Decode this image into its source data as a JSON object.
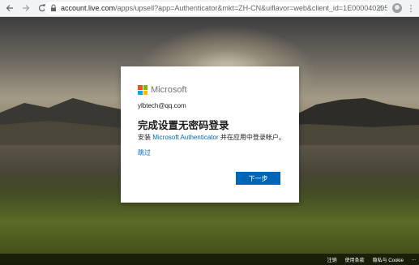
{
  "browser": {
    "url_host": "account.live.com",
    "url_path": "/apps/upsell?app=Authenticator&mkt=ZH-CN&uiflavor=web&client_id=1E0000402055498id=2..."
  },
  "dialog": {
    "brand": "Microsoft",
    "email": "ylbtech@qq.com",
    "title": "完成设置无密码登录",
    "desc_prefix": "安装 ",
    "desc_link": "Microsoft Authenticator",
    "desc_suffix": " 并在应用中登录帐户。",
    "skip_label": "跳过",
    "next_label": "下一步"
  },
  "footer": {
    "terms": "注销",
    "usage": "使用条款",
    "privacy": "隐私与 Cookie",
    "more": "..."
  },
  "colors": {
    "accent": "#0067b8",
    "ms_red": "#f25022",
    "ms_green": "#7fba00",
    "ms_blue": "#00a4ef",
    "ms_yellow": "#ffb900"
  }
}
